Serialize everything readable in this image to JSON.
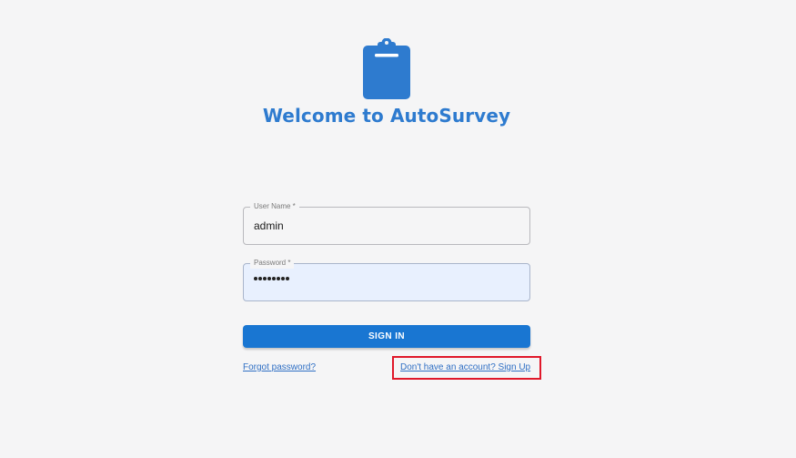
{
  "app": {
    "title": "Welcome to AutoSurvey",
    "logo_icon": "clipboard-icon",
    "accent_color": "#1976d2"
  },
  "form": {
    "username": {
      "label": "User Name *",
      "value": "admin"
    },
    "password": {
      "label": "Password *",
      "masked_length": 8
    },
    "submit_label": "SIGN IN"
  },
  "links": {
    "forgot": "Forgot password?",
    "signup": "Don't have an account? Sign Up"
  },
  "highlight_color": "#e0182a"
}
